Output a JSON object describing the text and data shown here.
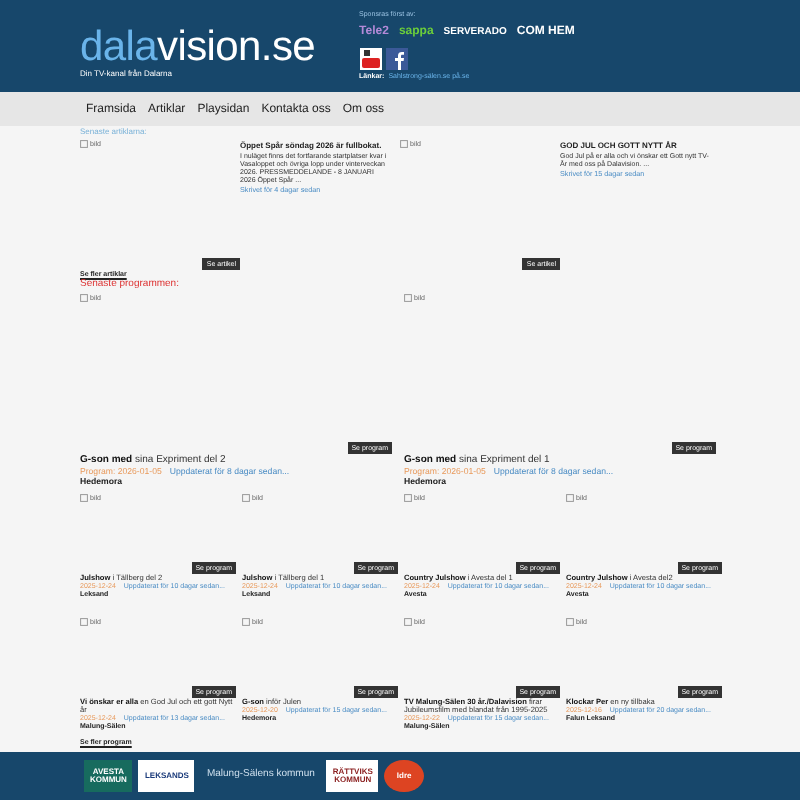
{
  "header": {
    "logo": [
      "dala",
      "vision",
      ".se"
    ],
    "tagline": "Din TV-kanal från Dalarna",
    "sponsor_label": "Sponsras först av:",
    "sponsors": [
      {
        "kind": "tele2",
        "text": "Tele2"
      },
      {
        "kind": "sappa",
        "text": "sappa"
      },
      {
        "kind": "serverado",
        "text": "SERVERADO"
      },
      {
        "kind": "comhem",
        "text": "COM HEM"
      }
    ],
    "links_label": "Länkar:",
    "link": "Sahlstrong-sälen.se på.se"
  },
  "nav": [
    "Framsida",
    "Artiklar",
    "Playsidan",
    "Kontakta oss",
    "Om oss"
  ],
  "articles_title": "Senaste artiklarna:",
  "articles": [
    {
      "image": "bild",
      "title": "Öppet Spår söndag 2026 är fullbokat.",
      "body": "I nuläget finns det fortfarande startplatser kvar i Vasaloppet och övriga lopp under vinterveckan 2026. PRESSMEDDELANDE - 8 JANUARI 2026 Öppet Spår ...",
      "meta": "Skrivet för 4 dagar sedan",
      "button": "Se artikel"
    },
    {
      "image": "bild",
      "title": "GOD JUL OCH GOTT NYTT ÅR",
      "body": "God Jul på er alla och vi önskar ett Gott nytt TV-År med oss på Dalavision. ...",
      "meta": "Skrivet för 15 dagar sedan",
      "button": "Se artikel"
    }
  ],
  "more_articles": "Se fler artiklar",
  "programs_title": "Senaste programmen:",
  "featured": [
    {
      "image": "bild",
      "button": "Se program",
      "title": "**G-son med** sina Expriment del 2",
      "date": "Program: 2026-01-05",
      "updated": "Uppdaterat för 8 dagar sedan...",
      "place": "Hedemora"
    },
    {
      "image": "bild",
      "button": "Se program",
      "title": "**G-son med** sina Expriment del 1",
      "date": "Program: 2026-01-05",
      "updated": "Uppdaterat för 8 dagar sedan...",
      "place": "Hedemora"
    }
  ],
  "programs": [
    {
      "image": "bild",
      "button": "Se program",
      "title": "**Julshow** i Tällberg del 2",
      "date": "2025-12-24",
      "updated": "Uppdaterat för 10 dagar sedan...",
      "place": "Leksand"
    },
    {
      "image": "bild",
      "button": "Se program",
      "title": "**Julshow** i Tällberg del 1",
      "date": "2025-12-24",
      "updated": "Uppdaterat för 10 dagar sedan...",
      "place": "Leksand"
    },
    {
      "image": "bild",
      "button": "Se program",
      "title": "**Country Julshow** i Avesta del 1",
      "date": "2025-12-24",
      "updated": "Uppdaterat för 10 dagar sedan...",
      "place": "Avesta"
    },
    {
      "image": "bild",
      "button": "Se program",
      "title": "**Country Julshow** i Avesta del2",
      "date": "2025-12-24",
      "updated": "Uppdaterat för 10 dagar sedan...",
      "place": "Avesta"
    },
    {
      "image": "bild",
      "button": "Se program",
      "title": "**Vi önskar er alla** en God Jul och ett gott Nytt år",
      "date": "2025-12-24",
      "updated": "Uppdaterat för 13 dagar sedan...",
      "place": "Malung-Sälen"
    },
    {
      "image": "bild",
      "button": "Se program",
      "title": "**G-son** inför Julen",
      "date": "2025-12-20",
      "updated": "Uppdaterat för 15 dagar sedan...",
      "place": "Hedemora"
    },
    {
      "image": "bild",
      "button": "Se program",
      "title": "**TV Malung-Sälen 30 år./Dalavision** firar Jubileumsfilm med blandat från 1995-2025",
      "date": "2025-12-22",
      "updated": "Uppdaterat för 15 dagar sedan...",
      "place": "Malung-Sälen"
    },
    {
      "image": "bild",
      "button": "Se program",
      "title": "**Klockar Per** en ny tillbaka",
      "date": "2025-12-16",
      "updated": "Uppdaterat för 20 dagar sedan...",
      "place": "Falun Leksand"
    }
  ],
  "more_programs": "Se fler program",
  "footer": [
    {
      "kind": "avesta",
      "lines": [
        "AVESTA",
        "KOMMUN"
      ]
    },
    {
      "kind": "leksand",
      "lines": [
        "LEKSANDS"
      ]
    },
    {
      "kind": "malung",
      "lines": [
        "Malung-Sälens kommun"
      ]
    },
    {
      "kind": "rattvik",
      "lines": [
        "RÄTTVIKS",
        "KOMMUN"
      ]
    },
    {
      "kind": "idre",
      "lines": [
        "Idre"
      ]
    }
  ]
}
